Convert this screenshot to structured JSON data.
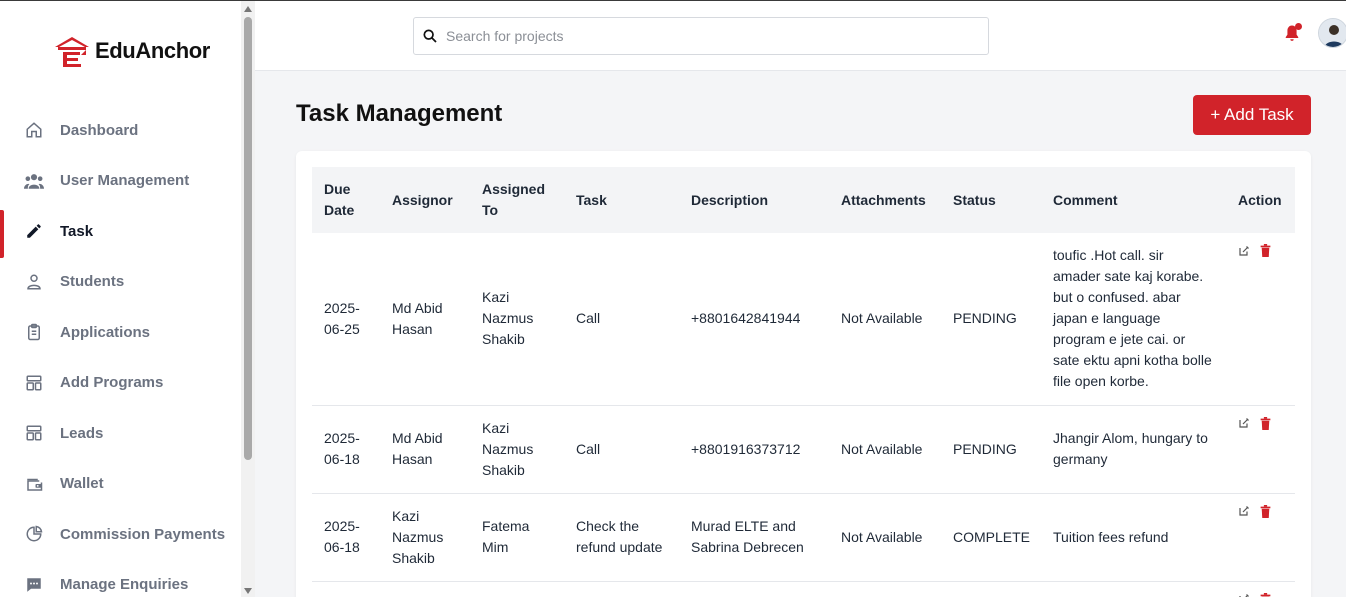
{
  "brand": {
    "name": "EduAnchor",
    "accent": "#d1232a"
  },
  "sidebar": {
    "items": [
      {
        "label": "Dashboard",
        "icon": "home-icon",
        "active": false
      },
      {
        "label": "User Management",
        "icon": "users-icon",
        "active": false
      },
      {
        "label": "Task",
        "icon": "pencil-icon",
        "active": true
      },
      {
        "label": "Students",
        "icon": "user-icon",
        "active": false
      },
      {
        "label": "Applications",
        "icon": "clipboard-icon",
        "active": false
      },
      {
        "label": "Add Programs",
        "icon": "layout-icon",
        "active": false
      },
      {
        "label": "Leads",
        "icon": "layout-icon",
        "active": false
      },
      {
        "label": "Wallet",
        "icon": "wallet-icon",
        "active": false
      },
      {
        "label": "Commission Payments",
        "icon": "pie-chart-icon",
        "active": false
      },
      {
        "label": "Manage Enquiries",
        "icon": "chat-icon",
        "active": false
      }
    ]
  },
  "header": {
    "search": {
      "placeholder": "Search for projects",
      "value": ""
    }
  },
  "main": {
    "title": "Task Management",
    "add_label": "+ Add Task"
  },
  "table": {
    "columns": [
      "Due Date",
      "Assignor",
      "Assigned To",
      "Task",
      "Description",
      "Attachments",
      "Status",
      "Comment",
      "Action"
    ],
    "rows": [
      {
        "due_date": "2025-06-25",
        "assignor": "Md Abid Hasan",
        "assigned_to": "Kazi Nazmus Shakib",
        "task": "Call",
        "description": "+8801642841944",
        "attachments": "Not Available",
        "status": "PENDING",
        "comment": "toufic .Hot call. sir amader sate kaj korabe. but o confused. abar japan e language program e jete cai. or sate ektu apni kotha bolle file open korbe."
      },
      {
        "due_date": "2025-06-18",
        "assignor": "Md Abid Hasan",
        "assigned_to": "Kazi Nazmus Shakib",
        "task": "Call",
        "description": "+8801916373712",
        "attachments": "Not Available",
        "status": "PENDING",
        "comment": "Jhangir Alom, hungary to germany"
      },
      {
        "due_date": "2025-06-18",
        "assignor": "Kazi Nazmus Shakib",
        "assigned_to": "Fatema Mim",
        "task": "Check the refund update",
        "description": "Murad ELTE and Sabrina Debrecen",
        "attachments": "Not Available",
        "status": "COMPLETE",
        "comment": "Tuition fees refund"
      }
    ]
  }
}
